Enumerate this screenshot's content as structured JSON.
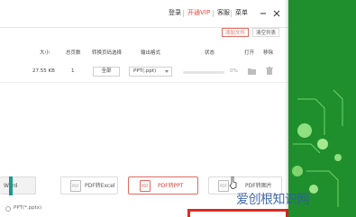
{
  "titlebar": {
    "login": "登录",
    "vip": "开通VIP",
    "client_service": "客服",
    "menu": "菜单"
  },
  "toolbar": {
    "add_file": "添加文件",
    "clear_list": "清空列表"
  },
  "table": {
    "headers": {
      "size": "大小",
      "total_pages": "总页数",
      "page_range": "转换页码选择",
      "output_format": "输出格式",
      "status": "状态",
      "open": "打开",
      "remove": "移除"
    },
    "rows": [
      {
        "size": "27.55 KB",
        "pages": "1",
        "page_range": "全部",
        "format": "PPT(.ppt)",
        "progress": "0%",
        "progress_value": 0
      }
    ]
  },
  "cards": [
    {
      "label": "Word",
      "icon": "file-word-icon"
    },
    {
      "label": "PDF转Excel",
      "icon": "file-excel-icon"
    },
    {
      "label": "PDF转PPT",
      "icon": "file-ppt-icon",
      "active": true
    },
    {
      "label": "PDF转图片",
      "icon": "file-image-icon"
    }
  ],
  "option": {
    "label": "PPT(*.pptx)"
  },
  "watermark": {
    "text": "爱创根知识网"
  },
  "colors": {
    "accent": "#e0453a",
    "desktop_green": "#1f8f2d",
    "highlight_red": "#e02a20"
  }
}
